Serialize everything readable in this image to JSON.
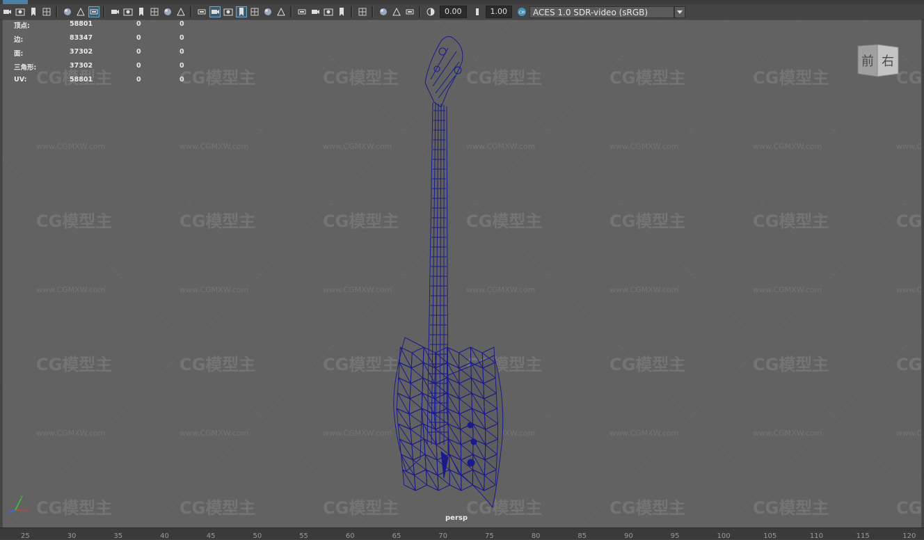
{
  "colors": {
    "mesh": "#1a1a8c",
    "viewport_bg": "#626262",
    "active": "#6fa7c9"
  },
  "toolbar": {
    "groups": [
      [
        "camera-icon",
        "camera-attr-icon",
        "bookmark-icon",
        "bookmark-flag-icon"
      ],
      [
        "image-plane-icon",
        "2d-pan-icon",
        "grease-pencil-icon"
      ],
      [
        "grid-icon",
        "film-gate-icon",
        "resolution-gate-icon",
        "gate-mask-icon",
        "field-chart-icon",
        "safe-action-icon"
      ],
      [
        "wireframe-icon",
        "smooth-shade-icon",
        "default-material-icon",
        "wireframe-on-shaded-icon",
        "textured-icon",
        "lights-icon",
        "shadows-icon"
      ],
      [
        "ambient-occlusion-icon",
        "motion-blur-icon",
        "anti-alias-icon",
        "depth-of-field-icon"
      ],
      [
        "isolate-select-icon"
      ],
      [
        "xray-icon",
        "xray-active-icon",
        "xray-joints-icon"
      ]
    ],
    "exposure": "0.00",
    "gamma": "1.00",
    "color_space": "ACES 1.0 SDR-video (sRGB)"
  },
  "hud": {
    "rows": [
      {
        "label": "顶点:",
        "v1": "58801",
        "v2": "0",
        "v3": "0"
      },
      {
        "label": "边:",
        "v1": "83347",
        "v2": "0",
        "v3": "0"
      },
      {
        "label": "面:",
        "v1": "37302",
        "v2": "0",
        "v3": "0"
      },
      {
        "label": "三角形:",
        "v1": "37302",
        "v2": "0",
        "v3": "0"
      },
      {
        "label": "UV:",
        "v1": "58801",
        "v2": "0",
        "v3": "0"
      }
    ]
  },
  "watermark": {
    "logo": "CG模型主",
    "url": "www.CGMXW.com"
  },
  "viewcube": {
    "front": "前",
    "right": "右"
  },
  "axis": {
    "x": "x",
    "y": "y",
    "z": "z"
  },
  "camera_label": "persp",
  "ruler": [
    "25",
    "30",
    "35",
    "40",
    "45",
    "50",
    "55",
    "60",
    "65",
    "70",
    "75",
    "80",
    "85",
    "90",
    "95",
    "100",
    "105",
    "110",
    "115",
    "120"
  ]
}
